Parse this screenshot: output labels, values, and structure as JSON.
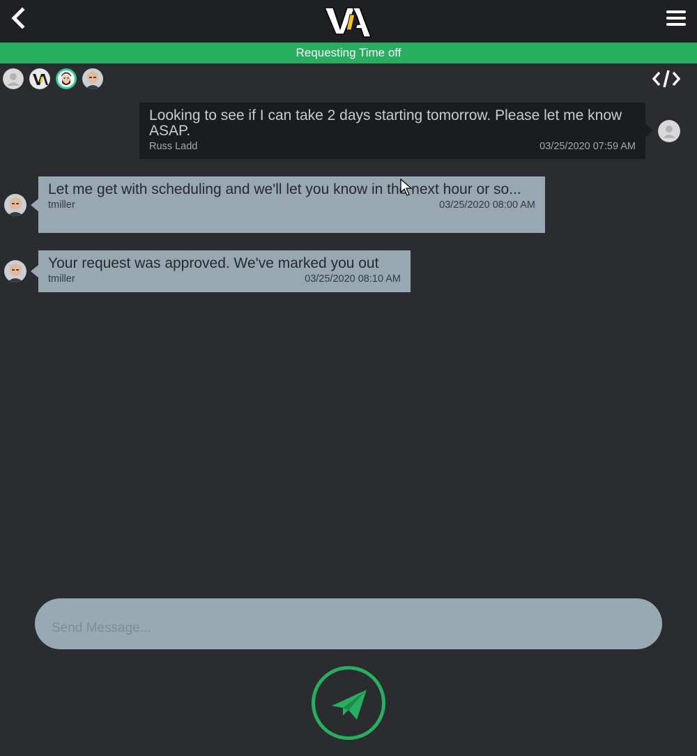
{
  "header": {
    "back_icon": "chevron-left-icon",
    "logo_text": "ViA",
    "menu_icon": "hamburger-menu-icon"
  },
  "banner": {
    "title": "Requesting Time off"
  },
  "participants": [
    {
      "name": "default-user",
      "icon": "person-icon"
    },
    {
      "name": "via-logo-user",
      "icon": "via-logo"
    },
    {
      "name": "bearded-user",
      "icon": "avatar"
    },
    {
      "name": "photo-user",
      "icon": "avatar"
    }
  ],
  "toolbar": {
    "code_icon": "code-icon"
  },
  "messages": [
    {
      "direction": "outgoing",
      "text": "Looking to see if I can take 2 days starting tomorrow.   Please let me know ASAP.",
      "author": "Russ Ladd",
      "timestamp": "03/25/2020 07:59 AM"
    },
    {
      "direction": "incoming",
      "text": "Let me get with scheduling and we'll let you know in the next hour or so...",
      "author": "tmiller",
      "timestamp": "03/25/2020 08:00 AM"
    },
    {
      "direction": "incoming",
      "text": "Your request was approved.  We've marked you out",
      "author": "tmiller",
      "timestamp": "03/25/2020 08:10 AM"
    }
  ],
  "composer": {
    "placeholder": "Send Message...",
    "value": ""
  },
  "send": {
    "icon": "paper-plane-icon"
  },
  "colors": {
    "accent": "#27ae5f",
    "background": "#2b2c30",
    "header": "#1f2023",
    "incoming_bubble": "#98a8b2",
    "outgoing_bubble": "#1b1c1f",
    "logo_yellow": "#f3c31b"
  }
}
